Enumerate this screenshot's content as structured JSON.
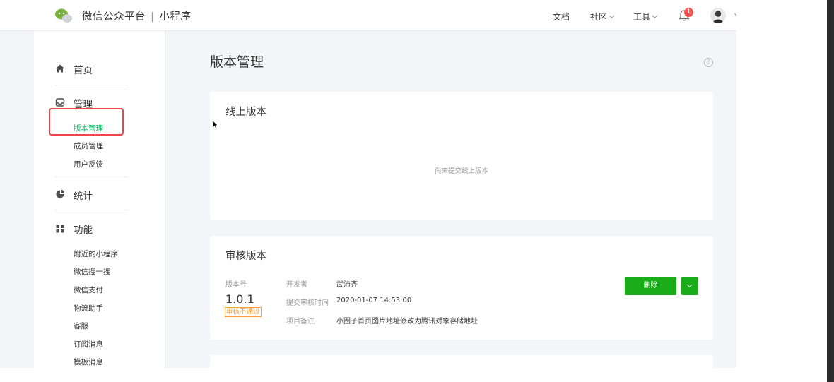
{
  "header": {
    "brand_name": "微信公众平台",
    "separator": "|",
    "product": "小程序",
    "nav": {
      "docs": "文档",
      "community": "社区",
      "tools": "工具"
    },
    "notification_count": "1"
  },
  "sidebar": {
    "sections": [
      {
        "label": "首页",
        "icon": "home-icon"
      },
      {
        "label": "管理",
        "icon": "inbox-icon"
      },
      {
        "label": "统计",
        "icon": "pie-chart-icon"
      },
      {
        "label": "功能",
        "icon": "grid-icon"
      }
    ],
    "manage_items": [
      "版本管理",
      "成员管理",
      "用户反馈"
    ],
    "feature_items": [
      "附近的小程序",
      "微信搜一搜",
      "微信支付",
      "物流助手",
      "客服",
      "订阅消息",
      "模板消息"
    ]
  },
  "main": {
    "title": "版本管理",
    "help_icon": "?",
    "online": {
      "title": "线上版本",
      "empty_text": "尚未提交线上版本"
    },
    "review": {
      "title": "审核版本",
      "version_label": "版本号",
      "version": "1.0.1",
      "status": "审核不通过",
      "developer_label": "开发者",
      "developer": "武沛齐",
      "submit_time_label": "提交审核时间",
      "submit_time": "2020-01-07 14:53:00",
      "remark_label": "项目备注",
      "remark": "小圈子首页图片地址修改为腾讯对象存储地址",
      "delete_label": "删除"
    }
  },
  "colors": {
    "accent": "#07c160",
    "button": "#1aad19",
    "warning": "#fa9d3b",
    "highlight": "#f0444f"
  }
}
